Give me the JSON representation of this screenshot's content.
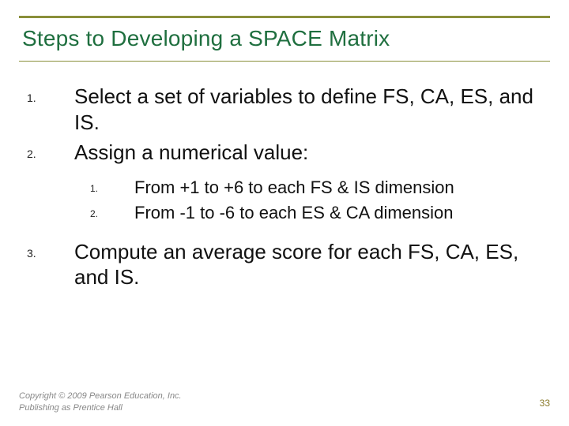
{
  "title": "Steps to Developing a SPACE Matrix",
  "items": [
    {
      "n": "1.",
      "t": "Select a set of variables to define FS, CA, ES, and IS."
    },
    {
      "n": "2.",
      "t": "Assign a numerical value:"
    }
  ],
  "sub": [
    {
      "n": "1.",
      "t": "From +1 to +6 to each FS & IS dimension"
    },
    {
      "n": "2.",
      "t": "From -1 to -6 to each ES & CA dimension"
    }
  ],
  "item3": {
    "n": "3.",
    "t": "Compute an average score for each FS, CA, ES, and IS."
  },
  "footer_line1": "Copyright © 2009 Pearson Education, Inc.",
  "footer_line2": "Publishing as Prentice Hall",
  "page": "33"
}
